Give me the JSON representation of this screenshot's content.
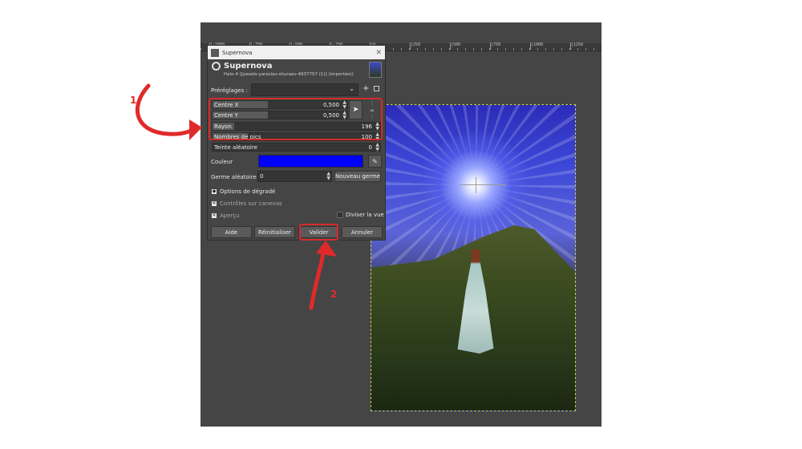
{
  "ruler": {
    "ticks": [
      "|-1000",
      "|-750",
      "|-500",
      "|-250",
      "|0",
      "|250",
      "|500",
      "|750",
      "|1000",
      "|1250"
    ]
  },
  "dialog": {
    "window_title": "Supernova",
    "plugin_name": "Supernova",
    "image_info": "Halo-4 ([pexels-yaroslav-shuraev-4937757 (1)] (importée))",
    "presets_label": "Préréglages :",
    "params": [
      {
        "label": "Centre X",
        "value": "0,500",
        "fill": 0.41
      },
      {
        "label": "Centre Y",
        "value": "0,500",
        "fill": 0.41
      },
      {
        "label": "Rayon",
        "value": "196",
        "fill": 0.13
      },
      {
        "label": "Nombres de pics",
        "value": "100",
        "fill": 0.21
      },
      {
        "label": "Teinte aléatoire",
        "value": "0",
        "fill": 0.0
      }
    ],
    "color_label": "Couleur",
    "color_value": "#0000ff",
    "seed_label": "Germe aléatoire",
    "seed_value": "0",
    "seed_button": "Nouveau germe",
    "blend_options": "Options de dégradé",
    "canvas_controls": "Contrôles sur canevas",
    "preview": "Aperçu",
    "split_view": "Diviser la vue",
    "buttons": {
      "help": "Aide",
      "reset": "Réinitialiser",
      "ok": "Valider",
      "cancel": "Annuler"
    }
  },
  "annotations": {
    "one": "1",
    "two": "2",
    "color": "#e02a2a"
  }
}
